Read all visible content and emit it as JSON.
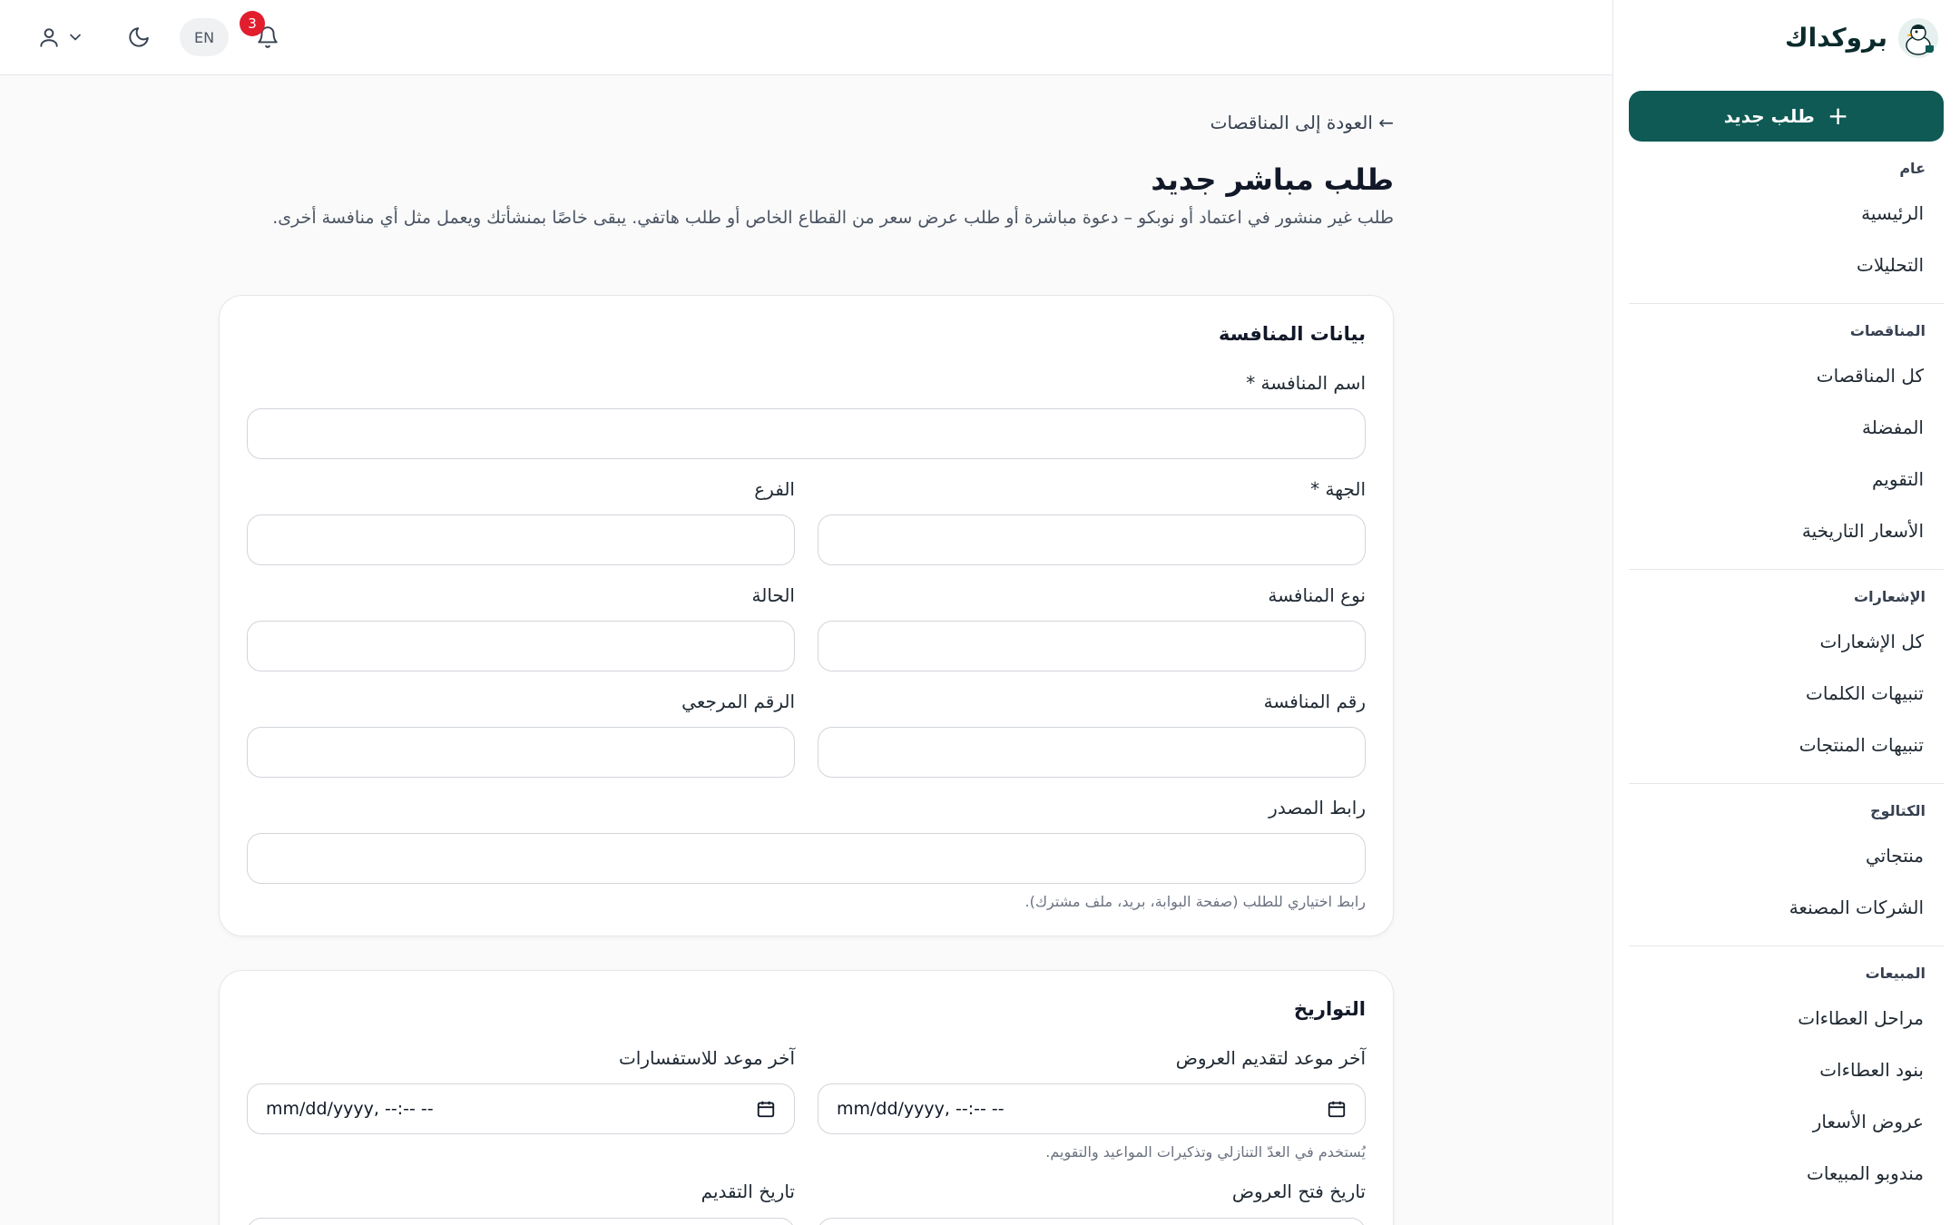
{
  "brand": {
    "name": "بروكداك"
  },
  "sidebar": {
    "new_request_label": "طلب جديد",
    "groups": [
      {
        "heading": "عام",
        "items": [
          "الرئيسية",
          "التحليلات"
        ]
      },
      {
        "heading": "المناقصات",
        "items": [
          "كل المناقصات",
          "المفضلة",
          "التقويم",
          "الأسعار التاريخية"
        ]
      },
      {
        "heading": "الإشعارات",
        "items": [
          "كل الإشعارات",
          "تنبيهات الكلمات",
          "تنبيهات المنتجات"
        ]
      },
      {
        "heading": "الكتالوج",
        "items": [
          "منتجاتي",
          "الشركات المصنعة"
        ]
      },
      {
        "heading": "المبيعات",
        "items": [
          "مراحل العطاءات",
          "بنود العطاءات",
          "عروض الأسعار",
          "مندوبو المبيعات"
        ]
      }
    ]
  },
  "topbar": {
    "notification_count": "3",
    "language": "EN"
  },
  "page": {
    "back_link": "← العودة إلى المناقصات",
    "title": "طلب مباشر جديد",
    "description": "طلب غير منشور في اعتماد أو نوبكو – دعوة مباشرة أو طلب عرض سعر من القطاع الخاص أو طلب هاتفي. يبقى خاصًا بمنشأتك ويعمل مثل أي منافسة أخرى."
  },
  "tender_section": {
    "title": "بيانات المنافسة",
    "name_label": "اسم المنافسة *",
    "entity_label": "الجهة *",
    "branch_label": "الفرع",
    "type_label": "نوع المنافسة",
    "status_label": "الحالة",
    "number_label": "رقم المنافسة",
    "reference_label": "الرقم المرجعي",
    "source_label": "رابط المصدر",
    "source_hint": "رابط اختياري للطلب (صفحة البوابة، بريد، ملف مشترك)."
  },
  "dates_section": {
    "title": "التواريخ",
    "bid_deadline_label": "آخر موعد لتقديم العروض",
    "inquiry_deadline_label": "آخر موعد للاستفسارات",
    "datetime_placeholder": "mm/dd/yyyy, --:-- --",
    "bid_deadline_hint": "يُستخدم في العدّ التنازلي وتذكيرات المواعيد والتقويم.",
    "opening_date_label": "تاريخ فتح العروض",
    "submission_date_label": "تاريخ التقديم"
  },
  "colors": {
    "primary": "#0f5a55",
    "badge": "#e11d2e"
  }
}
